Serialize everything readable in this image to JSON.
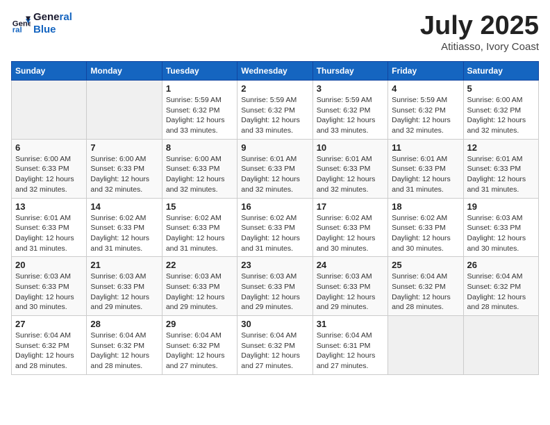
{
  "logo": {
    "line1": "General",
    "line2": "Blue"
  },
  "title": "July 2025",
  "subtitle": "Atitiasso, Ivory Coast",
  "days_of_week": [
    "Sunday",
    "Monday",
    "Tuesday",
    "Wednesday",
    "Thursday",
    "Friday",
    "Saturday"
  ],
  "weeks": [
    [
      {
        "day": "",
        "detail": ""
      },
      {
        "day": "",
        "detail": ""
      },
      {
        "day": "1",
        "detail": "Sunrise: 5:59 AM\nSunset: 6:32 PM\nDaylight: 12 hours and 33 minutes."
      },
      {
        "day": "2",
        "detail": "Sunrise: 5:59 AM\nSunset: 6:32 PM\nDaylight: 12 hours and 33 minutes."
      },
      {
        "day": "3",
        "detail": "Sunrise: 5:59 AM\nSunset: 6:32 PM\nDaylight: 12 hours and 33 minutes."
      },
      {
        "day": "4",
        "detail": "Sunrise: 5:59 AM\nSunset: 6:32 PM\nDaylight: 12 hours and 32 minutes."
      },
      {
        "day": "5",
        "detail": "Sunrise: 6:00 AM\nSunset: 6:32 PM\nDaylight: 12 hours and 32 minutes."
      }
    ],
    [
      {
        "day": "6",
        "detail": "Sunrise: 6:00 AM\nSunset: 6:33 PM\nDaylight: 12 hours and 32 minutes."
      },
      {
        "day": "7",
        "detail": "Sunrise: 6:00 AM\nSunset: 6:33 PM\nDaylight: 12 hours and 32 minutes."
      },
      {
        "day": "8",
        "detail": "Sunrise: 6:00 AM\nSunset: 6:33 PM\nDaylight: 12 hours and 32 minutes."
      },
      {
        "day": "9",
        "detail": "Sunrise: 6:01 AM\nSunset: 6:33 PM\nDaylight: 12 hours and 32 minutes."
      },
      {
        "day": "10",
        "detail": "Sunrise: 6:01 AM\nSunset: 6:33 PM\nDaylight: 12 hours and 32 minutes."
      },
      {
        "day": "11",
        "detail": "Sunrise: 6:01 AM\nSunset: 6:33 PM\nDaylight: 12 hours and 31 minutes."
      },
      {
        "day": "12",
        "detail": "Sunrise: 6:01 AM\nSunset: 6:33 PM\nDaylight: 12 hours and 31 minutes."
      }
    ],
    [
      {
        "day": "13",
        "detail": "Sunrise: 6:01 AM\nSunset: 6:33 PM\nDaylight: 12 hours and 31 minutes."
      },
      {
        "day": "14",
        "detail": "Sunrise: 6:02 AM\nSunset: 6:33 PM\nDaylight: 12 hours and 31 minutes."
      },
      {
        "day": "15",
        "detail": "Sunrise: 6:02 AM\nSunset: 6:33 PM\nDaylight: 12 hours and 31 minutes."
      },
      {
        "day": "16",
        "detail": "Sunrise: 6:02 AM\nSunset: 6:33 PM\nDaylight: 12 hours and 31 minutes."
      },
      {
        "day": "17",
        "detail": "Sunrise: 6:02 AM\nSunset: 6:33 PM\nDaylight: 12 hours and 30 minutes."
      },
      {
        "day": "18",
        "detail": "Sunrise: 6:02 AM\nSunset: 6:33 PM\nDaylight: 12 hours and 30 minutes."
      },
      {
        "day": "19",
        "detail": "Sunrise: 6:03 AM\nSunset: 6:33 PM\nDaylight: 12 hours and 30 minutes."
      }
    ],
    [
      {
        "day": "20",
        "detail": "Sunrise: 6:03 AM\nSunset: 6:33 PM\nDaylight: 12 hours and 30 minutes."
      },
      {
        "day": "21",
        "detail": "Sunrise: 6:03 AM\nSunset: 6:33 PM\nDaylight: 12 hours and 29 minutes."
      },
      {
        "day": "22",
        "detail": "Sunrise: 6:03 AM\nSunset: 6:33 PM\nDaylight: 12 hours and 29 minutes."
      },
      {
        "day": "23",
        "detail": "Sunrise: 6:03 AM\nSunset: 6:33 PM\nDaylight: 12 hours and 29 minutes."
      },
      {
        "day": "24",
        "detail": "Sunrise: 6:03 AM\nSunset: 6:33 PM\nDaylight: 12 hours and 29 minutes."
      },
      {
        "day": "25",
        "detail": "Sunrise: 6:04 AM\nSunset: 6:32 PM\nDaylight: 12 hours and 28 minutes."
      },
      {
        "day": "26",
        "detail": "Sunrise: 6:04 AM\nSunset: 6:32 PM\nDaylight: 12 hours and 28 minutes."
      }
    ],
    [
      {
        "day": "27",
        "detail": "Sunrise: 6:04 AM\nSunset: 6:32 PM\nDaylight: 12 hours and 28 minutes."
      },
      {
        "day": "28",
        "detail": "Sunrise: 6:04 AM\nSunset: 6:32 PM\nDaylight: 12 hours and 28 minutes."
      },
      {
        "day": "29",
        "detail": "Sunrise: 6:04 AM\nSunset: 6:32 PM\nDaylight: 12 hours and 27 minutes."
      },
      {
        "day": "30",
        "detail": "Sunrise: 6:04 AM\nSunset: 6:32 PM\nDaylight: 12 hours and 27 minutes."
      },
      {
        "day": "31",
        "detail": "Sunrise: 6:04 AM\nSunset: 6:31 PM\nDaylight: 12 hours and 27 minutes."
      },
      {
        "day": "",
        "detail": ""
      },
      {
        "day": "",
        "detail": ""
      }
    ]
  ]
}
